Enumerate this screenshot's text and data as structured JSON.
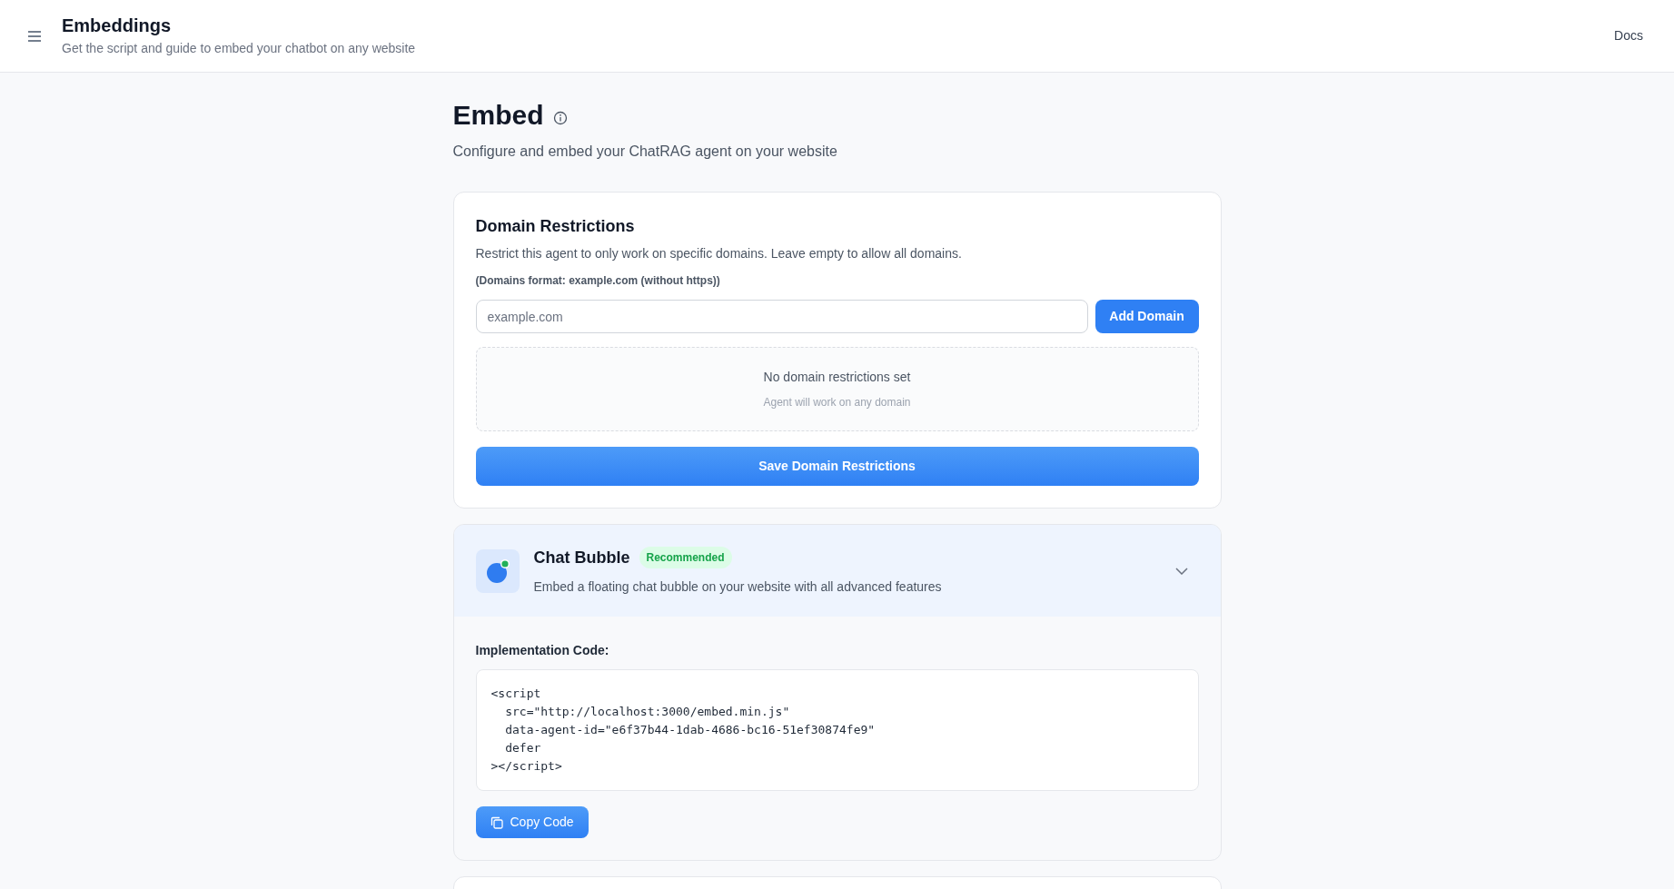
{
  "header": {
    "title": "Embeddings",
    "subtitle": "Get the script and guide to embed your chatbot on any website",
    "link": "Docs"
  },
  "page": {
    "title": "Embed",
    "subtitle": "Configure and embed your ChatRAG agent on your website"
  },
  "domain_restrictions": {
    "title": "Domain Restrictions",
    "description": "Restrict this agent to only work on specific domains. Leave empty to allow all domains.",
    "format_note": "(Domains format: example.com (without https))",
    "input": {
      "placeholder": "example.com"
    },
    "add_button": "Add Domain",
    "empty_title": "No domain restrictions set",
    "empty_subtitle": "Agent will work on any domain",
    "save_button": "Save Domain Restrictions"
  },
  "embed_options": [
    {
      "title": "Chat Bubble",
      "badge": "Recommended",
      "description": "Embed a floating chat bubble on your website with all advanced features",
      "expanded": true,
      "code_label": "Implementation Code:",
      "code_lines": [
        "<script",
        "  src=\"http://localhost:3000/embed.min.js\"",
        "  data-agent-id=\"e6f37b44-1dab-4686-bc16-51ef30874fe9\"",
        "  defer",
        "></script>"
      ],
      "copy_button": "Copy Code"
    }
  ]
}
